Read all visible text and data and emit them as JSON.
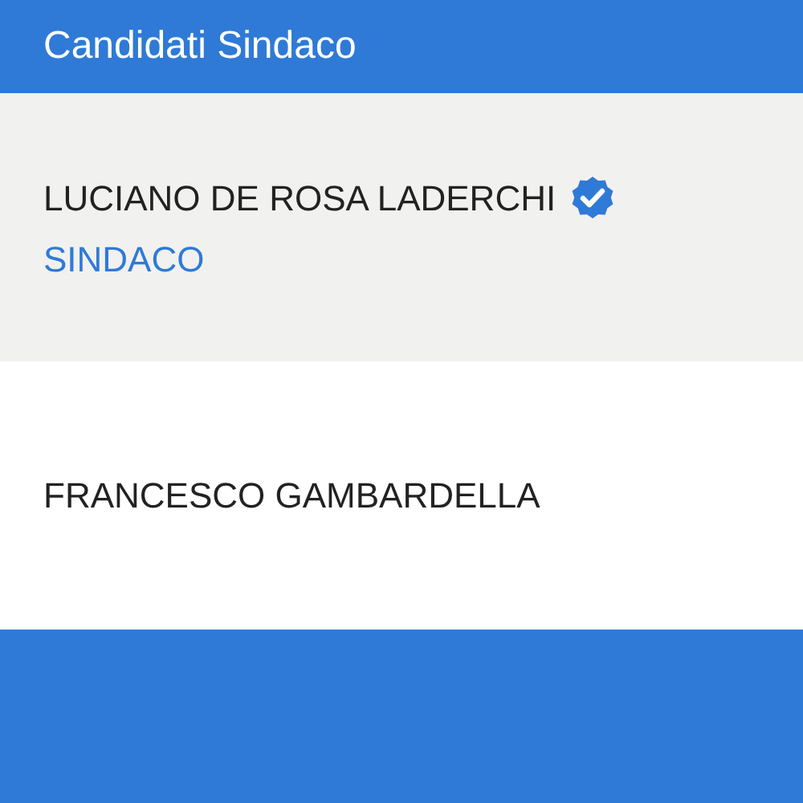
{
  "header": {
    "title": "Candidati Sindaco"
  },
  "candidates": [
    {
      "name": "LUCIANO DE ROSA LADERCHI",
      "verified": true,
      "role": "SINDACO",
      "highlighted": true
    },
    {
      "name": "FRANCESCO GAMBARDELLA",
      "verified": false,
      "highlighted": false
    }
  ]
}
